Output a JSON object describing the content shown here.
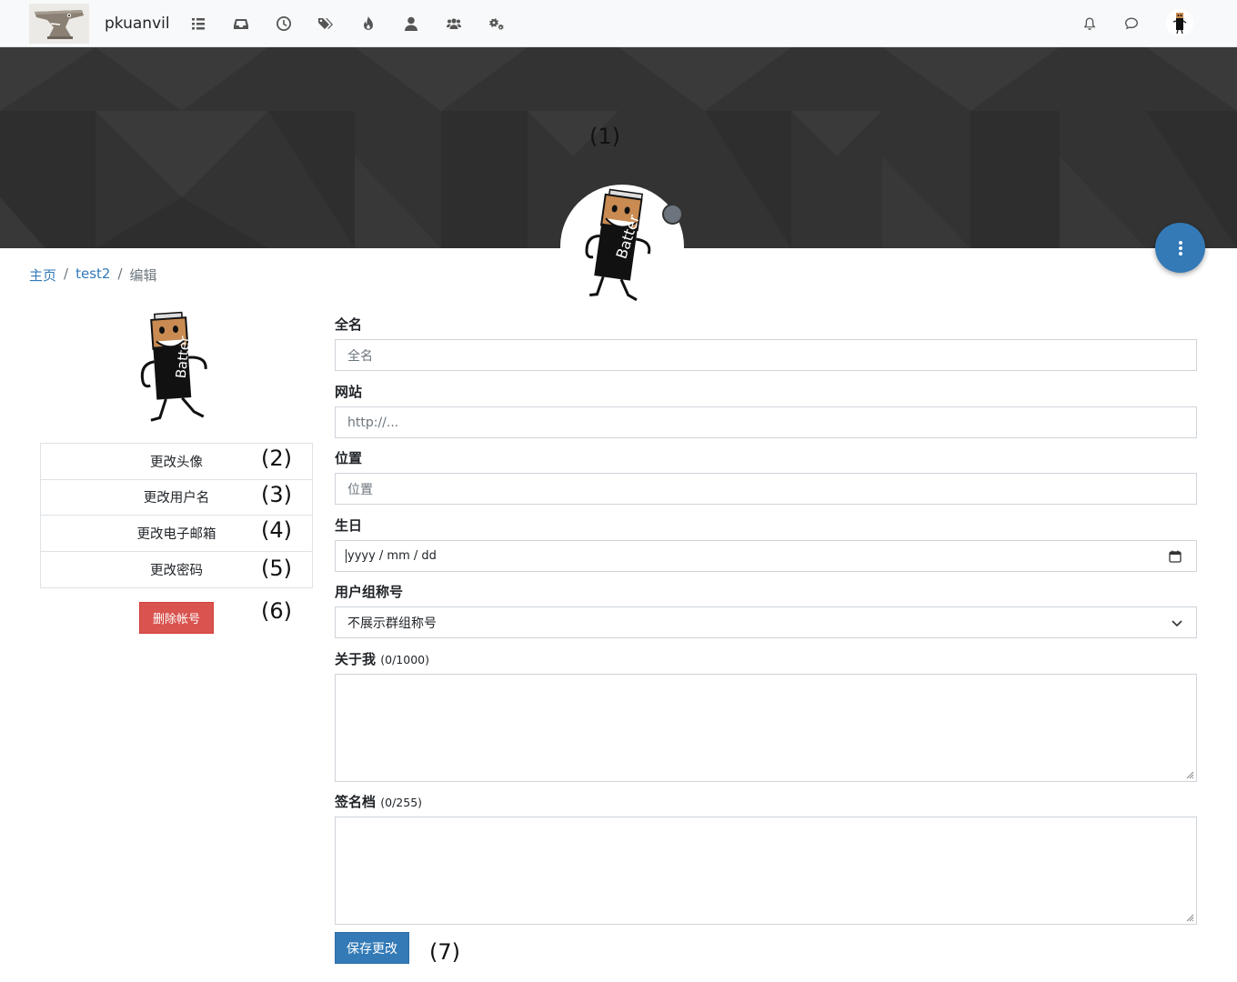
{
  "navbar": {
    "brand": "pkuanvil",
    "icons": [
      "list-icon",
      "inbox-icon",
      "clock-icon",
      "tags-icon",
      "fire-icon",
      "user-icon",
      "users-icon",
      "gears-icon"
    ],
    "right_icons": [
      "bell-icon",
      "chat-icon"
    ]
  },
  "cover": {
    "label": "(1)"
  },
  "breadcrumb": {
    "home": "主页",
    "user": "test2",
    "current": "编辑",
    "sep": "/"
  },
  "sidebar": {
    "items": [
      {
        "label": "更改头像",
        "marker": "(2)"
      },
      {
        "label": "更改用户名",
        "marker": "(3)"
      },
      {
        "label": "更改电子邮箱",
        "marker": "(4)"
      },
      {
        "label": "更改密码",
        "marker": "(5)"
      }
    ],
    "delete_label": "删除帐号",
    "delete_marker": "(6)"
  },
  "form": {
    "fullname": {
      "label": "全名",
      "placeholder": "全名"
    },
    "website": {
      "label": "网站",
      "placeholder": "http://..."
    },
    "location": {
      "label": "位置",
      "placeholder": "位置"
    },
    "birthday": {
      "label": "生日",
      "placeholder": "yyyy / mm / dd"
    },
    "group_title": {
      "label": "用户组称号",
      "value": "不展示群组称号"
    },
    "aboutme": {
      "label": "关于我",
      "count": "(0/1000)"
    },
    "signature": {
      "label": "签名档",
      "count": "(0/255)"
    },
    "save_label": "保存更改",
    "save_marker": "(7)"
  },
  "colors": {
    "accent": "#337ab7",
    "danger": "#d9534f",
    "cover": "#333333"
  }
}
